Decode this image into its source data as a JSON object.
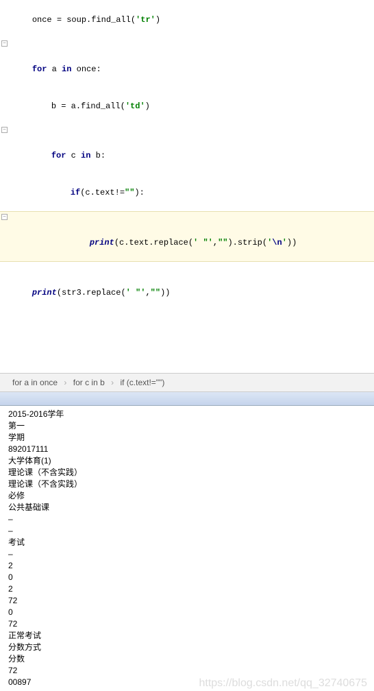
{
  "code": {
    "l1_pre": "once = soup.find_all(",
    "l1_str": "'tr'",
    "l1_post": ")",
    "l2_kw1": "for",
    "l2_a": " a ",
    "l2_kw2": "in",
    "l2_post": " once:",
    "l3_pre": "b = a.find_all(",
    "l3_str": "'td'",
    "l3_post": ")",
    "l4_kw1": "for",
    "l4_c": " c ",
    "l4_kw2": "in",
    "l4_post": " b:",
    "l5_kw": "if",
    "l5_pre": "(c.text!=",
    "l5_str": "\"\"",
    "l5_post": "):",
    "l6_kw": "print",
    "l6_pre": "(c.text.replace(",
    "l6_s1": "' \"'",
    "l6_mid": ",",
    "l6_s2": "\"\"",
    "l6_mid2": ").strip(",
    "l6_s3_pre": "'",
    "l6_esc": "\\n",
    "l6_s3_post": "'",
    "l6_post": "))",
    "l7_kw": "print",
    "l7_pre": "(str3.replace(",
    "l7_s1": "' \"'",
    "l7_mid": ",",
    "l7_s2": "\"\"",
    "l7_post": "))"
  },
  "breadcrumb": {
    "b1": "for a in once",
    "b2": "for c in b",
    "b3": "if (c.text!=\"\")"
  },
  "output": [
    "2015-2016学年",
    "第一",
    "学期",
    "892017111",
    "大学体育(1)",
    "理论课（不含实践）",
    "理论课（不含实践）",
    "必修",
    "公共基础课",
    "–",
    "–",
    "考试",
    "–",
    "2",
    "0",
    "2",
    "72",
    "0",
    "72",
    "正常考试",
    "分数方式",
    "分数",
    "72",
    "00897"
  ],
  "watermark": "https://blog.csdn.net/qq_32740675"
}
